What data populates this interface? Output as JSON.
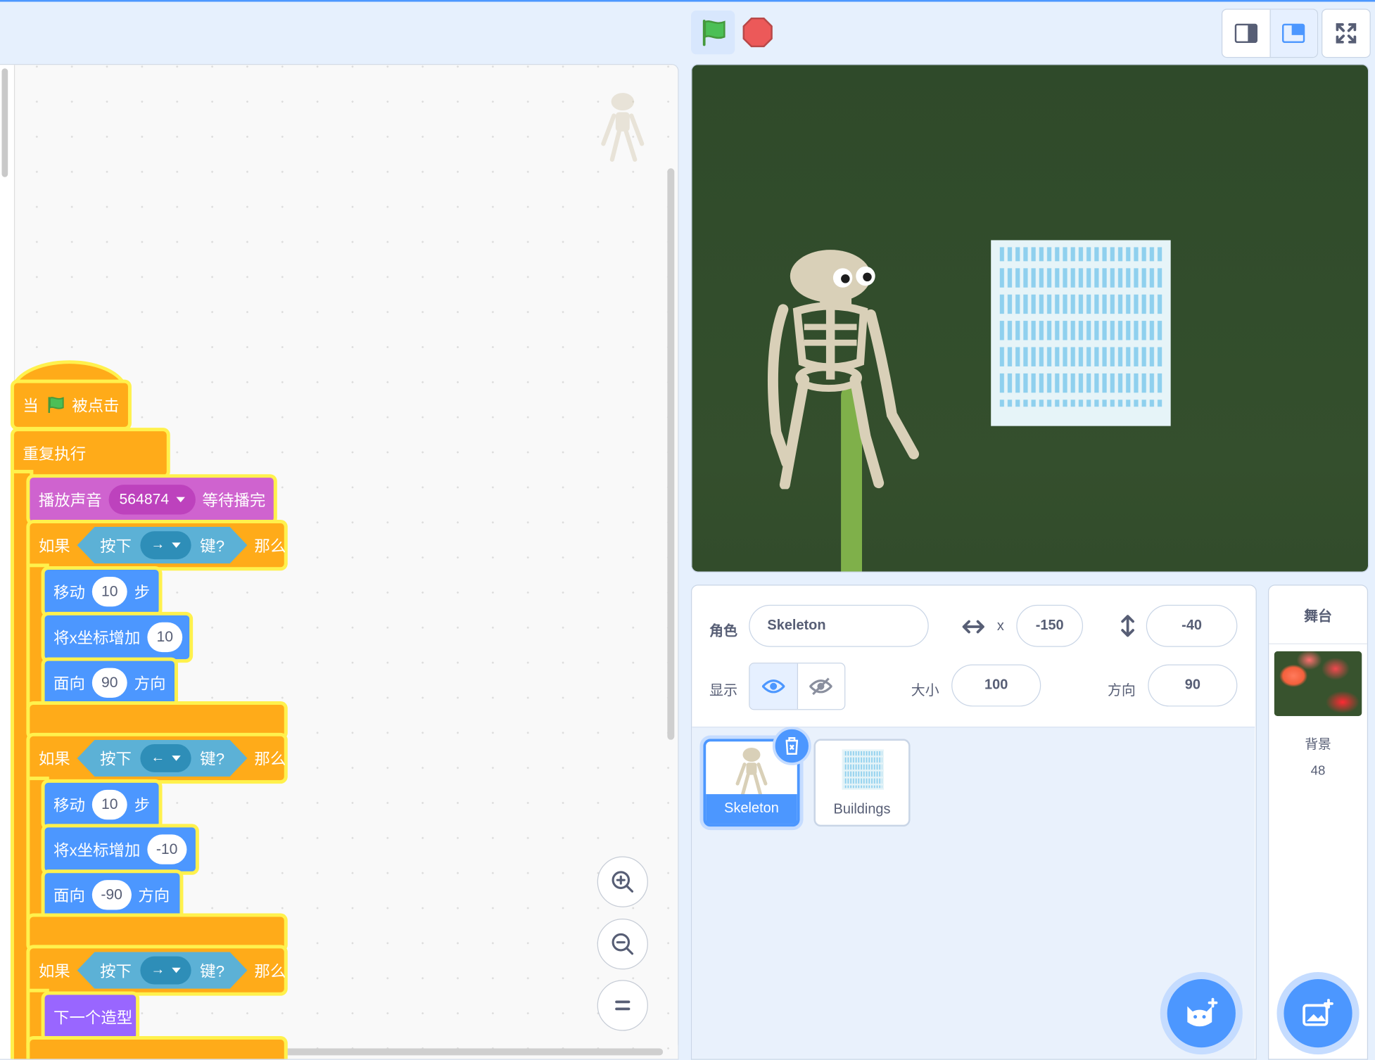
{
  "colors": {
    "motion": "#4c97ff",
    "control": "#ffab19",
    "sound": "#cf63cf",
    "sensing": "#5cb1d6",
    "looks": "#9966ff",
    "highlight": "#fff14d"
  },
  "toolbar": {
    "green_flag_icon": "green-flag-icon",
    "stop_icon": "stop-sign-icon"
  },
  "script": {
    "hat": {
      "when": "当",
      "clicked": "被点击"
    },
    "forever": "重复执行",
    "play_sound": {
      "label": "播放声音",
      "sound": "564874",
      "suffix": "等待播完"
    },
    "if1": {
      "if": "如果",
      "press": "按下",
      "key": "→",
      "keyq": "键?",
      "then": "那么",
      "move": "移动",
      "move_val": "10",
      "steps": "步",
      "changex": "将x坐标增加",
      "changex_val": "10",
      "point": "面向",
      "point_val": "90",
      "dir": "方向"
    },
    "if2": {
      "if": "如果",
      "press": "按下",
      "key": "←",
      "keyq": "键?",
      "then": "那么",
      "move": "移动",
      "move_val": "10",
      "steps": "步",
      "changex": "将x坐标增加",
      "changex_val": "-10",
      "point": "面向",
      "point_val": "-90",
      "dir": "方向"
    },
    "if3": {
      "if": "如果",
      "press": "按下",
      "key": "→",
      "keyq": "键?",
      "then": "那么",
      "next_costume": "下一个造型"
    }
  },
  "sprite_info": {
    "sprite_label": "角色",
    "sprite_name": "Skeleton",
    "x_label": "x",
    "x_value": "-150",
    "y_label": "y",
    "y_value": "-40",
    "show_label": "显示",
    "size_label": "大小",
    "size_value": "100",
    "direction_label": "方向",
    "direction_value": "90"
  },
  "sprites": [
    {
      "name": "Skeleton",
      "selected": true
    },
    {
      "name": "Buildings",
      "selected": false
    }
  ],
  "stage_pane": {
    "title": "舞台",
    "backdrop_label": "背景",
    "backdrop_count": "48"
  }
}
